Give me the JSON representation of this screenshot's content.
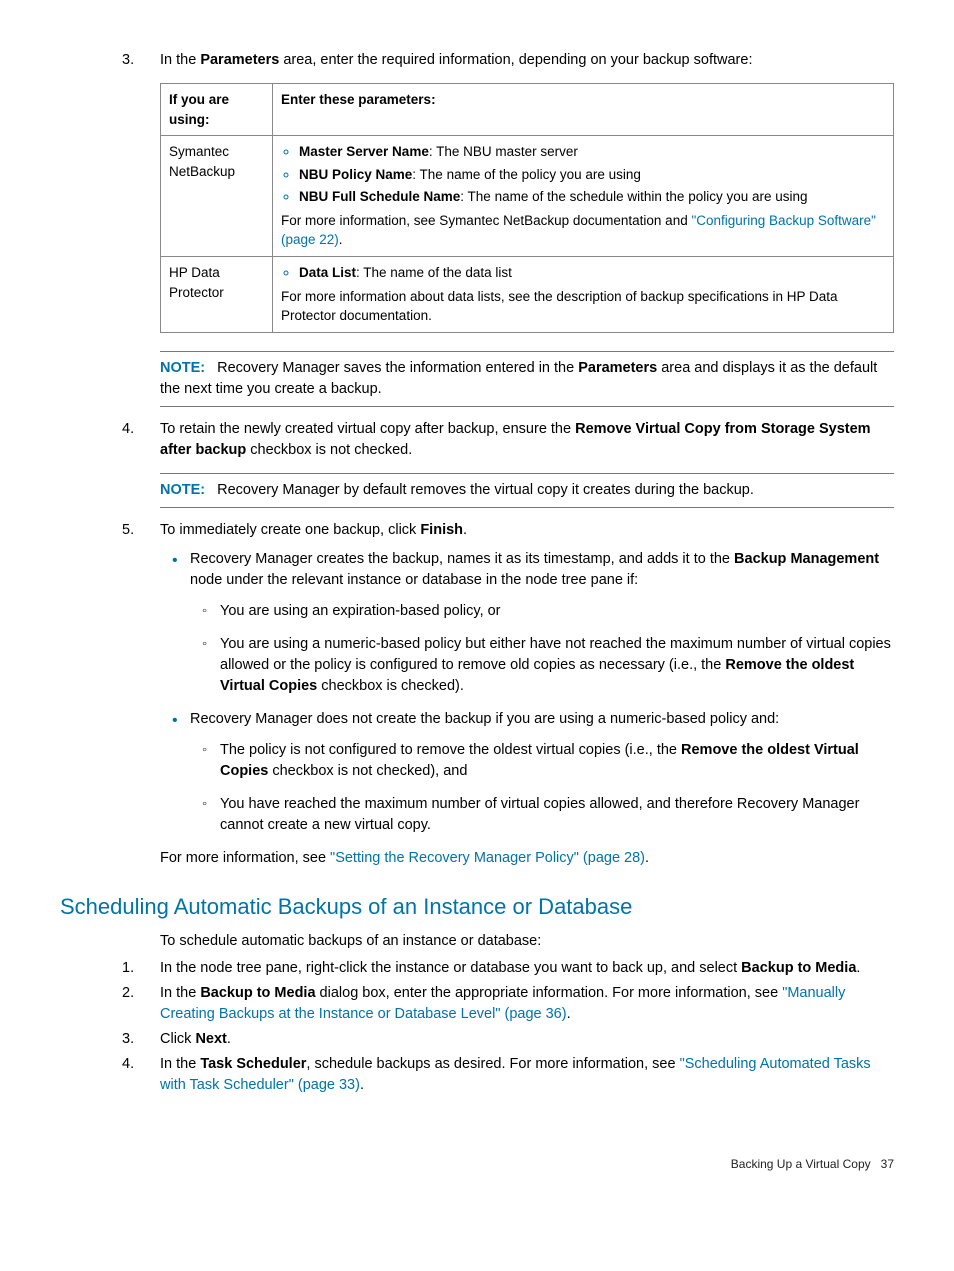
{
  "step3": {
    "num": "3.",
    "text_a": "In the ",
    "text_b": "Parameters",
    "text_c": " area, enter the required information, depending on your backup software:"
  },
  "table": {
    "h1": "If you are using:",
    "h2": "Enter these parameters:",
    "r1": {
      "col1": "Symantec NetBackup",
      "b1a": "Master Server Name",
      "b1b": ": The NBU master server",
      "b2a": "NBU Policy Name",
      "b2b": ": The name of the policy you are using",
      "b3a": "NBU Full Schedule Name",
      "b3b": ": The name of the schedule within the policy you are using",
      "more_a": "For more information, see Symantec NetBackup documentation and ",
      "more_link": "\"Configuring Backup Software\" (page 22)",
      "more_c": "."
    },
    "r2": {
      "col1": "HP Data Protector",
      "b1a": "Data List",
      "b1b": ": The name of the data list",
      "more": "For more information about data lists, see the description of backup specifications in HP Data Protector documentation."
    }
  },
  "note1": {
    "label": "NOTE:",
    "a": "Recovery Manager saves the information entered in the ",
    "b": "Parameters",
    "c": " area and displays it as the default the next time you create a backup."
  },
  "step4": {
    "num": "4.",
    "a": "To retain the newly created virtual copy after backup, ensure the ",
    "b": "Remove Virtual Copy from Storage System after backup",
    "c": " checkbox is not checked."
  },
  "note2": {
    "label": "NOTE:",
    "text": "Recovery Manager by default removes the virtual copy it creates during the backup."
  },
  "step5": {
    "num": "5.",
    "a": "To immediately create one backup, click ",
    "b": "Finish",
    "c": ".",
    "bul1_a": "Recovery Manager creates the backup, names it as its timestamp, and adds it to the ",
    "bul1_b": "Backup Management",
    "bul1_c": " node under the relevant instance or database in the node tree pane if:",
    "s1a": "You are using an expiration-based policy, or",
    "s1b_a": "You are using a numeric-based policy but either have not reached the maximum number of virtual copies allowed or the policy is configured to remove old copies as necessary (i.e., the ",
    "s1b_b": "Remove the oldest Virtual Copies",
    "s1b_c": " checkbox is checked).",
    "bul2": "Recovery Manager does not create the backup if you are using a numeric-based policy and:",
    "s2a_a": "The policy is not configured to remove the oldest virtual copies (i.e., the ",
    "s2a_b": "Remove the oldest Virtual Copies",
    "s2a_c": " checkbox is not checked), and",
    "s2b": "You have reached the maximum number of virtual copies allowed, and therefore Recovery Manager cannot create a new virtual copy.",
    "more_a": "For more information, see ",
    "more_link": "\"Setting the Recovery Manager Policy\" (page 28)",
    "more_c": "."
  },
  "heading": "Scheduling Automatic Backups of an Instance or Database",
  "intro": "To schedule automatic backups of an instance or database:",
  "o1": {
    "num": "1.",
    "a": "In the node tree pane, right-click the instance or database you want to back up, and select ",
    "b": "Backup to Media",
    "c": "."
  },
  "o2": {
    "num": "2.",
    "a": "In the ",
    "b": "Backup to Media",
    "c": " dialog box, enter the appropriate information. For more information, see ",
    "link": "\"Manually Creating Backups at the Instance or Database Level\" (page 36)",
    "e": "."
  },
  "o3": {
    "num": "3.",
    "a": "Click ",
    "b": "Next",
    "c": "."
  },
  "o4": {
    "num": "4.",
    "a": "In the ",
    "b": "Task Scheduler",
    "c": ", schedule backups as desired. For more information, see ",
    "link": "\"Scheduling Automated Tasks with Task Scheduler\" (page 33)",
    "e": "."
  },
  "footer": {
    "section": "Backing Up a Virtual Copy",
    "page": "37"
  }
}
